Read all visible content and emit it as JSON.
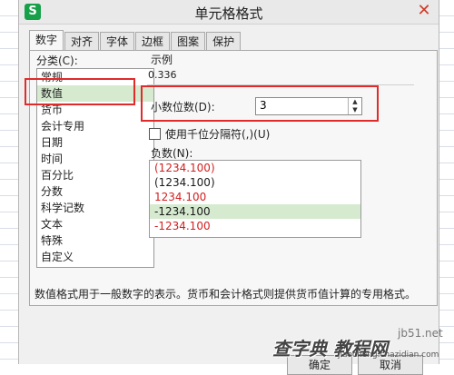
{
  "window": {
    "title": "单元格格式",
    "app_icon_text": "S"
  },
  "tabs": [
    {
      "label": "数字",
      "active": true
    },
    {
      "label": "对齐",
      "active": false
    },
    {
      "label": "字体",
      "active": false
    },
    {
      "label": "边框",
      "active": false
    },
    {
      "label": "图案",
      "active": false
    },
    {
      "label": "保护",
      "active": false
    }
  ],
  "category": {
    "label": "分类(C):",
    "items": [
      "常规",
      "数值",
      "货币",
      "会计专用",
      "日期",
      "时间",
      "百分比",
      "分数",
      "科学记数",
      "文本",
      "特殊",
      "自定义"
    ],
    "selected_index": 1
  },
  "sample": {
    "label": "示例",
    "value": "0.336"
  },
  "decimal_places": {
    "label": "小数位数(D):",
    "value": "3"
  },
  "thousands_separator": {
    "label": "使用千位分隔符(,)(U)",
    "checked": false
  },
  "negative_numbers": {
    "label": "负数(N):",
    "items": [
      {
        "text": "(1234.100)",
        "color": "#d22020"
      },
      {
        "text": "(1234.100)",
        "color": "#1a1a1a"
      },
      {
        "text": "1234.100",
        "color": "#d22020"
      },
      {
        "text": "-1234.100",
        "color": "#1a1a1a"
      },
      {
        "text": "-1234.100",
        "color": "#d22020"
      }
    ],
    "selected_index": 3
  },
  "description": "数值格式用于一般数字的表示。货币和会计格式则提供货币值计算的专用格式。",
  "buttons": {
    "ok": "确定",
    "cancel": "取消"
  },
  "watermark": {
    "main": "查字典 教程网",
    "site": "jb51.net",
    "url": "jiaocheng.chazidian.com"
  },
  "colors": {
    "highlight": "#e02b2b",
    "selection": "#d6ead0",
    "app_icon": "#16a04a"
  }
}
